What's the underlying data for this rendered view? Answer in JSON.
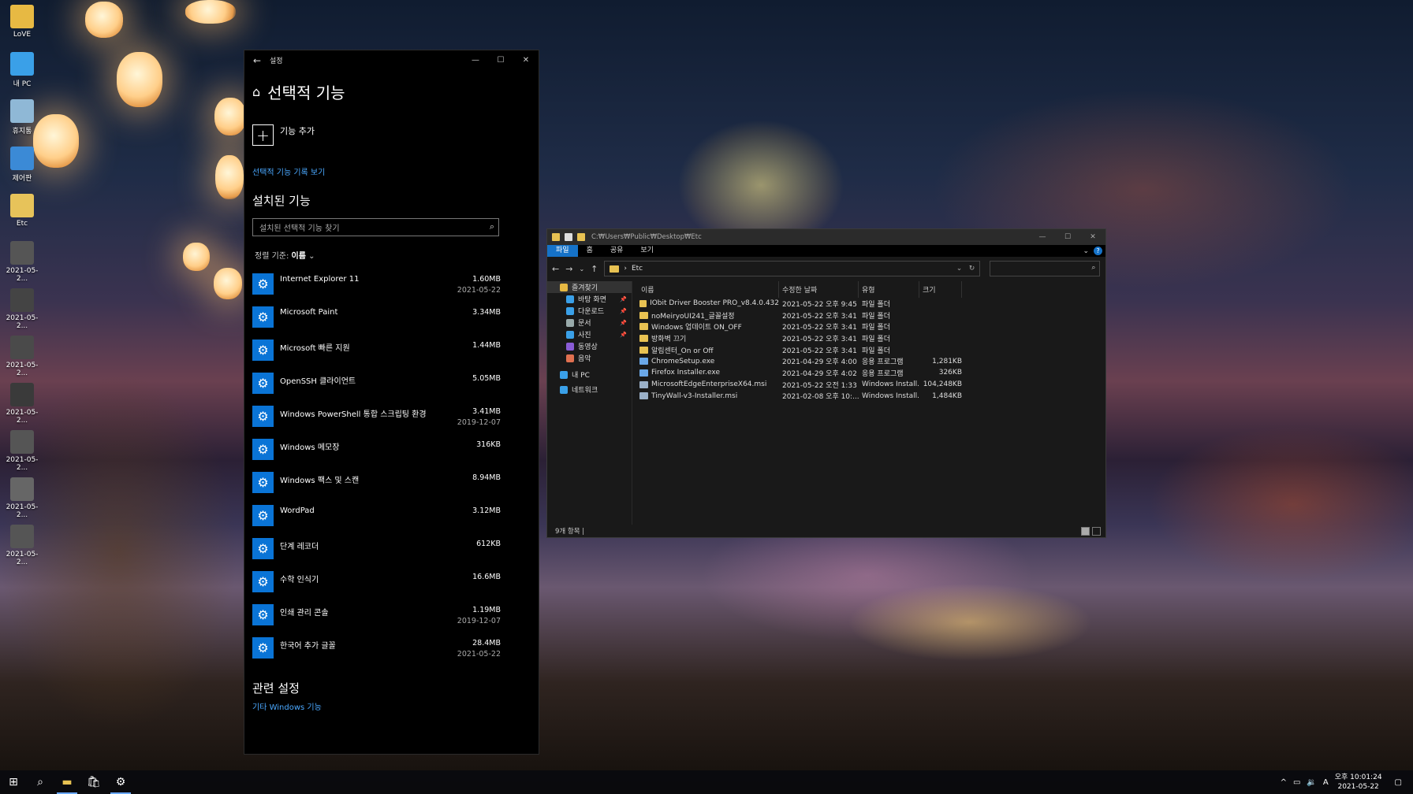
{
  "desktop": {
    "icons": [
      {
        "label": "LoVE",
        "color": "#e7b943"
      },
      {
        "label": "내 PC",
        "color": "#3aa0e8"
      },
      {
        "label": "휴지통",
        "color": "#8fb8d6"
      },
      {
        "label": "제어판",
        "color": "#3b8ad6"
      },
      {
        "label": "Etc",
        "color": "#e7c35a"
      },
      {
        "label": "2021-05-2...",
        "color": "#555"
      },
      {
        "label": "2021-05-2...",
        "color": "#444"
      },
      {
        "label": "2021-05-2...",
        "color": "#4a4a4a"
      },
      {
        "label": "2021-05-2...",
        "color": "#3a3a3a"
      },
      {
        "label": "2021-05-2...",
        "color": "#555"
      },
      {
        "label": "2021-05-2...",
        "color": "#666"
      },
      {
        "label": "2021-05-2...",
        "color": "#555"
      }
    ]
  },
  "settings": {
    "window_title": "설정",
    "heading": "선택적 기능",
    "add_feature": "기능 추가",
    "history_link": "선택적 기능 기록 보기",
    "installed_heading": "설치된 기능",
    "search_placeholder": "설치된 선택적 기능 찾기",
    "sort_label": "정렬 기준:",
    "sort_value": "이름",
    "features": [
      {
        "name": "Internet Explorer 11",
        "size": "1.60MB",
        "date": "2021-05-22"
      },
      {
        "name": "Microsoft Paint",
        "size": "3.34MB",
        "date": ""
      },
      {
        "name": "Microsoft 빠른 지원",
        "size": "1.44MB",
        "date": ""
      },
      {
        "name": "OpenSSH 클라이언트",
        "size": "5.05MB",
        "date": ""
      },
      {
        "name": "Windows PowerShell 통합 스크립팅 환경",
        "size": "3.41MB",
        "date": "2019-12-07"
      },
      {
        "name": "Windows 메모장",
        "size": "316KB",
        "date": ""
      },
      {
        "name": "Windows 팩스 및 스캔",
        "size": "8.94MB",
        "date": ""
      },
      {
        "name": "WordPad",
        "size": "3.12MB",
        "date": ""
      },
      {
        "name": "단계 레코더",
        "size": "612KB",
        "date": ""
      },
      {
        "name": "수학 인식기",
        "size": "16.6MB",
        "date": ""
      },
      {
        "name": "인쇄 관리 콘솔",
        "size": "1.19MB",
        "date": "2019-12-07"
      },
      {
        "name": "한국어 추가 글꼴",
        "size": "28.4MB",
        "date": "2021-05-22"
      }
    ],
    "related_heading": "관련 설정",
    "related_link": "기타 Windows 기능"
  },
  "explorer": {
    "title_path": "C:₩Users₩Public₩Desktop₩Etc",
    "ribbon_tabs": [
      "파일",
      "홈",
      "공유",
      "보기"
    ],
    "address": "Etc",
    "nav": [
      {
        "label": "즐겨찾기",
        "color": "#e7b943",
        "indent": 0,
        "pin": false,
        "selected": true
      },
      {
        "label": "바탕 화면",
        "color": "#3aa0e8",
        "indent": 1,
        "pin": true,
        "selected": false
      },
      {
        "label": "다운로드",
        "color": "#3aa0e8",
        "indent": 1,
        "pin": true,
        "selected": false
      },
      {
        "label": "문서",
        "color": "#9aa",
        "indent": 1,
        "pin": true,
        "selected": false
      },
      {
        "label": "사진",
        "color": "#3aa0e8",
        "indent": 1,
        "pin": true,
        "selected": false
      },
      {
        "label": "동영상",
        "color": "#8a5cd6",
        "indent": 1,
        "pin": false,
        "selected": false
      },
      {
        "label": "음악",
        "color": "#e07050",
        "indent": 1,
        "pin": false,
        "selected": false
      },
      {
        "label": "내 PC",
        "color": "#3aa0e8",
        "indent": 0,
        "pin": false,
        "selected": false
      },
      {
        "label": "네트워크",
        "color": "#3aa0e8",
        "indent": 0,
        "pin": false,
        "selected": false
      }
    ],
    "columns": [
      "이름",
      "수정한 날짜",
      "유형",
      "크기"
    ],
    "files": [
      {
        "name": "IObit Driver Booster PRO_v8.4.0.432",
        "date": "2021-05-22 오후 9:45",
        "type": "파일 폴더",
        "size": "",
        "kind": "folder"
      },
      {
        "name": "noMeiryoUI241_글꼴설정",
        "date": "2021-05-22 오후 3:41",
        "type": "파일 폴더",
        "size": "",
        "kind": "folder"
      },
      {
        "name": "Windows 업데이트 ON_OFF",
        "date": "2021-05-22 오후 3:41",
        "type": "파일 폴더",
        "size": "",
        "kind": "folder"
      },
      {
        "name": "방화벽 끄기",
        "date": "2021-05-22 오후 3:41",
        "type": "파일 폴더",
        "size": "",
        "kind": "folder"
      },
      {
        "name": "알림센터_On or Off",
        "date": "2021-05-22 오후 3:41",
        "type": "파일 폴더",
        "size": "",
        "kind": "folder"
      },
      {
        "name": "ChromeSetup.exe",
        "date": "2021-04-29 오후 4:00",
        "type": "응용 프로그램",
        "size": "1,281KB",
        "kind": "exe"
      },
      {
        "name": "Firefox Installer.exe",
        "date": "2021-04-29 오후 4:02",
        "type": "응용 프로그램",
        "size": "326KB",
        "kind": "exe"
      },
      {
        "name": "MicrosoftEdgeEnterpriseX64.msi",
        "date": "2021-05-22 오전 1:33",
        "type": "Windows Install...",
        "size": "104,248KB",
        "kind": "msi"
      },
      {
        "name": "TinyWall-v3-Installer.msi",
        "date": "2021-02-08 오후 10:...",
        "type": "Windows Install...",
        "size": "1,484KB",
        "kind": "msi"
      }
    ],
    "status": "9개 항목 |"
  },
  "taskbar": {
    "time": "오후 10:01:24",
    "date": "2021-05-22",
    "ime": "A"
  }
}
